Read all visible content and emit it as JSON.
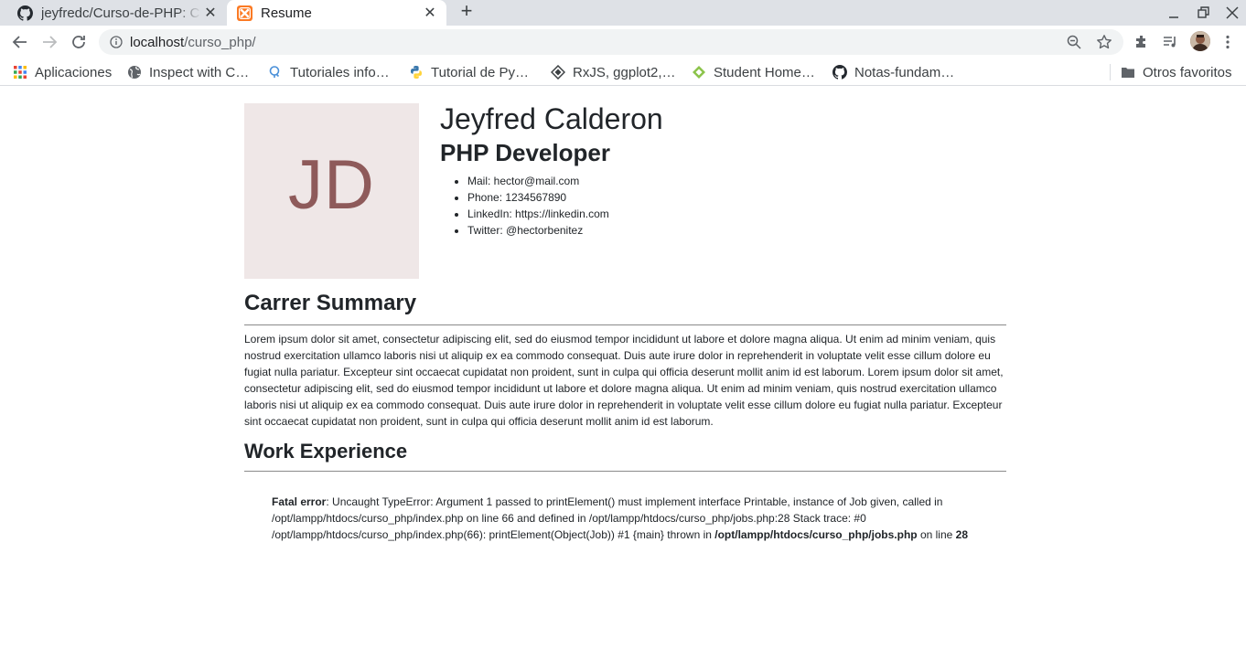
{
  "browser": {
    "tabs": [
      {
        "title": "jeyfredc/Curso-de-PHP: Curso de PHP",
        "icon": "github-icon",
        "active": false
      },
      {
        "title": "Resume",
        "icon": "xampp-icon",
        "active": true
      }
    ],
    "address": {
      "host": "localhost",
      "path": "/curso_php/"
    },
    "bookmarks": [
      {
        "label": "Aplicaciones",
        "icon": "apps-grid-icon"
      },
      {
        "label": "Inspect with C…",
        "icon": "globe-icon"
      },
      {
        "label": "Tutoriales info…",
        "icon": "search-bulb-icon"
      },
      {
        "label": "Tutorial de Py…",
        "icon": "python-icon"
      },
      {
        "label": "RxJS, ggplot2,…",
        "icon": "diamond-icon"
      },
      {
        "label": "Student Home…",
        "icon": "leaf-icon"
      },
      {
        "label": "Notas-fundam…",
        "icon": "github-icon"
      }
    ],
    "other_bookmarks": "Otros favoritos"
  },
  "profile": {
    "initials": "JD",
    "name": "Jeyfred Calderon",
    "role": "PHP Developer",
    "contacts": [
      "Mail: hector@mail.com",
      "Phone: 1234567890",
      "LinkedIn: https://linkedin.com",
      "Twitter: @hectorbenitez"
    ]
  },
  "summary": {
    "heading": "Carrer Summary",
    "text": "Lorem ipsum dolor sit amet, consectetur adipiscing elit, sed do eiusmod tempor incididunt ut labore et dolore magna aliqua. Ut enim ad minim veniam, quis nostrud exercitation ullamco laboris nisi ut aliquip ex ea commodo consequat. Duis aute irure dolor in reprehenderit in voluptate velit esse cillum dolore eu fugiat nulla pariatur. Excepteur sint occaecat cupidatat non proident, sunt in culpa qui officia deserunt mollit anim id est laborum. Lorem ipsum dolor sit amet, consectetur adipiscing elit, sed do eiusmod tempor incididunt ut labore et dolore magna aliqua. Ut enim ad minim veniam, quis nostrud exercitation ullamco laboris nisi ut aliquip ex ea commodo consequat. Duis aute irure dolor in reprehenderit in voluptate velit esse cillum dolore eu fugiat nulla pariatur. Excepteur sint occaecat cupidatat non proident, sunt in culpa qui officia deserunt mollit anim id est laborum."
  },
  "work": {
    "heading": "Work Experience",
    "error_label": "Fatal error",
    "error_message": ": Uncaught TypeError: Argument 1 passed to printElement() must implement interface Printable, instance of Job given, called in /opt/lampp/htdocs/curso_php/index.php on line 66 and defined in /opt/lampp/htdocs/curso_php/jobs.php:28 Stack trace: #0 /opt/lampp/htdocs/curso_php/index.php(66): printElement(Object(Job)) #1 {main} thrown in ",
    "error_file": "/opt/lampp/htdocs/curso_php/jobs.php",
    "error_on_line": " on line ",
    "error_line": "28"
  },
  "colors": {
    "photo_bg": "#efe7e7",
    "initials": "#8e5a5a"
  }
}
